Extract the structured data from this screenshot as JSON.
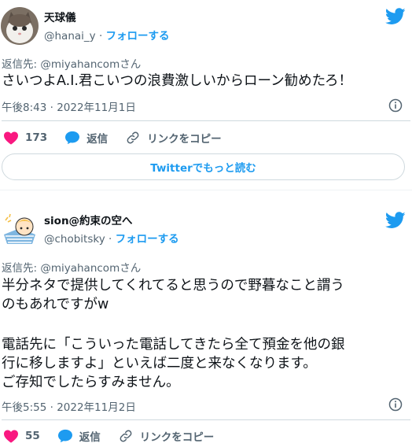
{
  "tweets": [
    {
      "display_name": "天球儀",
      "handle": "@hanai_y",
      "dot": " · ",
      "follow_label": "フォローする",
      "reply_to": "返信先: @miyahancomさん",
      "body_lines": [
        "さいつよA.I.君こいつの浪費激しいからローン勧めたろ！"
      ],
      "timestamp": "午後8:43 · 2022年11月1日",
      "like_count": "173",
      "reply_label": "返信",
      "copy_link_label": "リンクをコピー",
      "read_more_label": "Twitterでもっと読む"
    },
    {
      "display_name": "sion@約束の空へ",
      "handle": "@chobitsky",
      "dot": " · ",
      "follow_label": "フォローする",
      "reply_to": "返信先: @miyahancomさん",
      "body_lines": [
        "半分ネタで提供してくれてると思うので野暮なこと謂う",
        "のもあれですがw",
        "",
        "電話先に「こういった電話してきたら全て預金を他の銀",
        "行に移しますよ」といえば二度と来なくなります。",
        "ご存知でしたらすみません。"
      ],
      "timestamp": "午後5:55 · 2022年11月2日",
      "like_count": "55",
      "reply_label": "返信",
      "copy_link_label": "リンクをコピー"
    }
  ],
  "colors": {
    "accent": "#1d9bf0",
    "like": "#f91880",
    "secondary_text": "#536471"
  },
  "icons": [
    "twitter-bird-icon",
    "info-icon",
    "heart-icon",
    "speech-bubble-icon",
    "link-icon"
  ]
}
